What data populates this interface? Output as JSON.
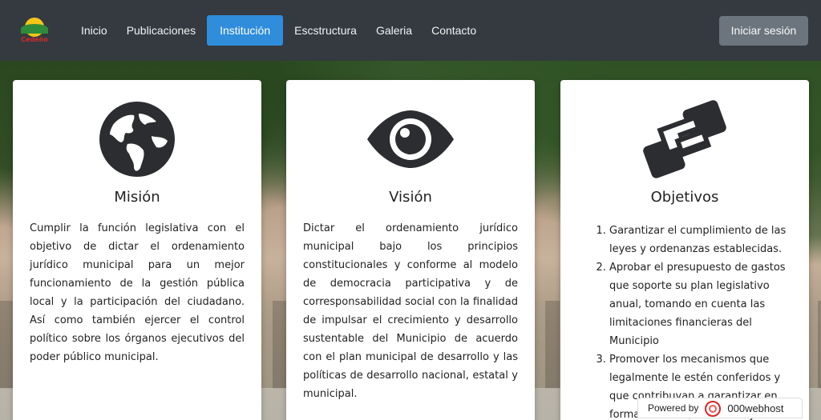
{
  "nav": {
    "brand_text": "Cedeño",
    "links": [
      {
        "label": "Inicio",
        "active": false
      },
      {
        "label": "Publicaciones",
        "active": false
      },
      {
        "label": "Institución",
        "active": true
      },
      {
        "label": "Escstructura",
        "active": false
      },
      {
        "label": "Galeria",
        "active": false
      },
      {
        "label": "Contacto",
        "active": false
      }
    ],
    "login_label": "Iniciar sesión"
  },
  "cards": [
    {
      "icon": "globe-icon",
      "title": "Misión",
      "text": "Cumplir la función legislativa con el objetivo de dictar el ordenamiento jurídico municipal para un mejor funcionamiento de la gestión pública local y la participación del ciudadano. Así como también ejercer el control político sobre los órganos ejecutivos del poder público municipal."
    },
    {
      "icon": "eye-icon",
      "title": "Visión",
      "text": "Dictar el ordenamiento jurídico municipal bajo los principios constitucionales y conforme al modelo de democracia participativa y de corresponsabilidad social con la finalidad de impulsar el crecimiento y desarrollo sustentable del Municipio de acuerdo con el plan municipal de desarrollo y las políticas de desarrollo nacional, estatal y municipal."
    },
    {
      "icon": "handshake-icon",
      "title": "Objetivos",
      "items": [
        "Garantizar el cumplimiento de las leyes y ordenanzas establecidas.",
        "Aprobar el presupuesto de gastos que soporte su plan legislativo anual, tomando en cuenta las limitaciones financieras del Municipio",
        "Promover los mecanismos que legalmente le estén conferidos y que contribuyan a garantizar en forma eficiente, suficiente y"
      ]
    }
  ],
  "footer": {
    "powered_by": "Powered by",
    "host": "000webhost"
  }
}
